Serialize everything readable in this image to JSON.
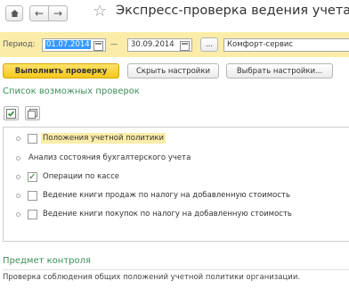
{
  "window": {
    "title": "Экспресс-проверка ведения учета"
  },
  "period": {
    "label": "Период:",
    "from": "01.07.2014",
    "dash": "—",
    "to": "30.09.2014",
    "ellipsis": "...",
    "organization": "Комфорт-сервис"
  },
  "actions": {
    "run": "Выполнить проверку",
    "hide_settings": "Скрыть настройки",
    "choose_settings": "Выбрать настройки..."
  },
  "checks": {
    "title": "Список возможных проверок",
    "items": [
      {
        "label": "Положения учетной политики",
        "checked": false,
        "highlighted": true
      },
      {
        "label": "Анализ состояния бухгалтерского учета",
        "checked": null,
        "highlighted": false
      },
      {
        "label": "Операции по кассе",
        "checked": true,
        "highlighted": false
      },
      {
        "label": "Ведение книги продаж по налогу на добавленную стоимость",
        "checked": false,
        "highlighted": false
      },
      {
        "label": "Ведение книги покупок по налогу на добавленную стоимость",
        "checked": false,
        "highlighted": false
      }
    ]
  },
  "subject": {
    "title": "Предмет контроля",
    "text": "Проверка соблюдения общих положений учетной политики организации."
  },
  "colors": {
    "accent_yellow": "#fbeda9",
    "section_green": "#3d8f5a",
    "selection_blue": "#3399ff"
  }
}
